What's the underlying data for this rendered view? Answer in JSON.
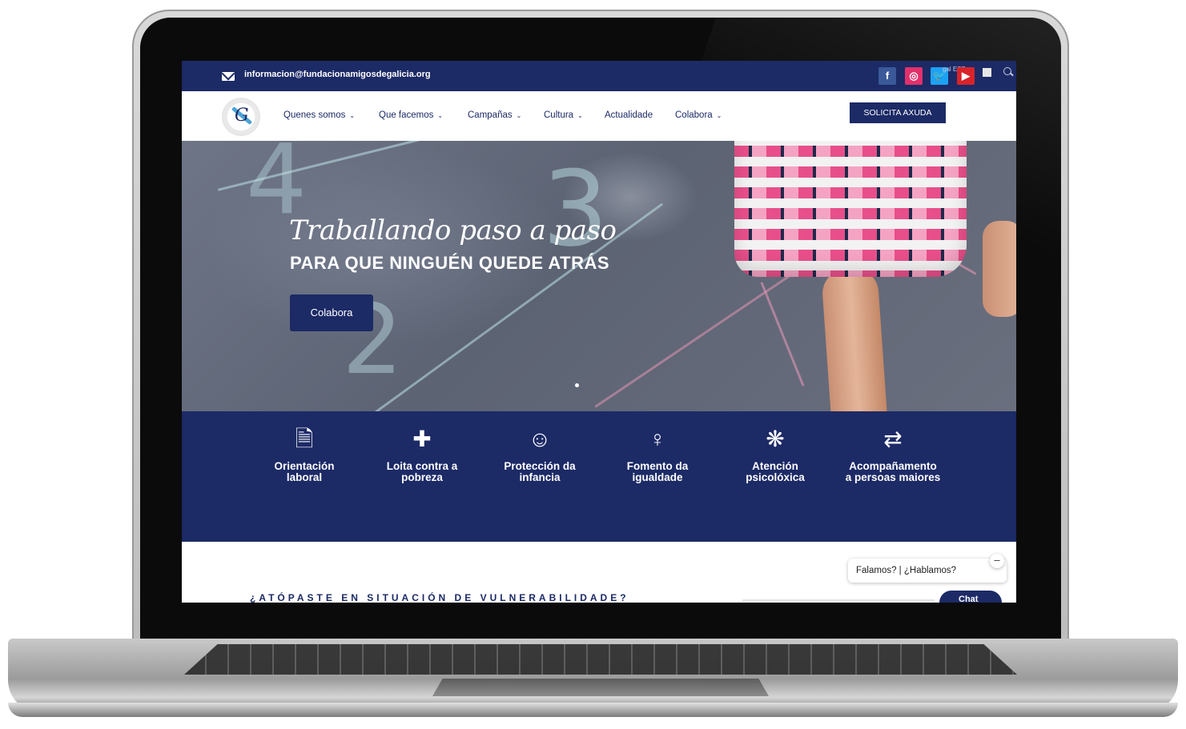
{
  "topbar": {
    "email": "informacion@fundacionamigosdegalicia.org",
    "lang": "gal ESP",
    "social": {
      "facebook": "f",
      "instagram": "◎",
      "twitter": "🐦",
      "youtube": "▶"
    }
  },
  "nav": {
    "items": [
      {
        "label": "Quenes somos",
        "has_dropdown": true
      },
      {
        "label": "Que facemos",
        "has_dropdown": true
      },
      {
        "label": "Campañas",
        "has_dropdown": true
      },
      {
        "label": "Cultura",
        "has_dropdown": true
      },
      {
        "label": "Actualidade",
        "has_dropdown": false
      },
      {
        "label": "Colabora",
        "has_dropdown": true
      }
    ],
    "chevron": "⌄",
    "cta": "SOLICITA AXUDA",
    "logo_letter": "G"
  },
  "hero": {
    "script": "Traballando paso a paso",
    "title": "PARA QUE NINGUÉN QUEDE ATRÁS",
    "button": "Colabora",
    "digits": {
      "three": "3",
      "two": "2",
      "four": "4"
    }
  },
  "services": [
    {
      "icon": "🗎",
      "icon_name": "document-search-icon",
      "label": "Orientación laboral"
    },
    {
      "icon": "✚",
      "icon_name": "hand-plus-icon",
      "label": "Loita contra a pobreza"
    },
    {
      "icon": "☺",
      "icon_name": "child-icon",
      "label": "Protección da infancia"
    },
    {
      "icon": "♀",
      "icon_name": "female-symbol-icon",
      "label": "Fomento da igualdade"
    },
    {
      "icon": "❋",
      "icon_name": "brain-icon",
      "label": "Atención psicolóxica"
    },
    {
      "icon": "⇄",
      "icon_name": "people-arrows-icon",
      "label": "Acompañamento a persoas maiores"
    }
  ],
  "section": {
    "heading": "¿ATÓPASTE EN SITUACIÓN DE VULNERABILIDADE?"
  },
  "chat": {
    "bubble": "Falamos? | ¿Hablamos?",
    "close": "–",
    "button": "Chat"
  },
  "colors": {
    "navy": "#1c2a66",
    "accent_blue": "#4aa4d8"
  }
}
